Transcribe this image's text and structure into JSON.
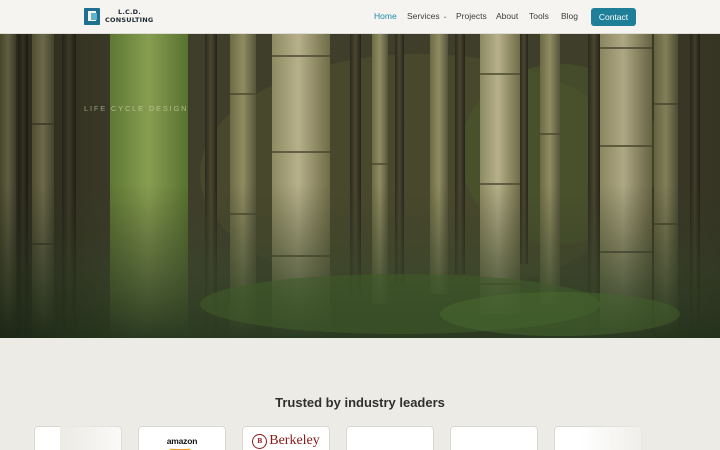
{
  "brand": {
    "line1": "L.C.D.",
    "line2": "CONSULTING",
    "accent": "#1f7f99"
  },
  "nav": {
    "items": [
      {
        "label": "Home",
        "active": true
      },
      {
        "label": "Services",
        "has_dropdown": true
      },
      {
        "label": "Projects"
      },
      {
        "label": "About"
      },
      {
        "label": "Tools"
      },
      {
        "label": "Blog"
      }
    ],
    "contact_label": "Contact",
    "dropdown_icon": "chevron-down-icon"
  },
  "hero": {
    "eyebrow": "LIFE CYCLE DESIGN",
    "background": "bamboo-forest-photo"
  },
  "trusted": {
    "title": "Trusted by industry leaders",
    "logos": [
      {
        "name": ""
      },
      {
        "name": "amazon"
      },
      {
        "name": "Berkeley",
        "seal": "B"
      },
      {
        "name": ""
      },
      {
        "name": ""
      },
      {
        "name": ""
      }
    ]
  },
  "colors": {
    "nav_active": "#1f8bad",
    "contact_button": "#1f7f99",
    "page_background": "#ecebe6"
  }
}
